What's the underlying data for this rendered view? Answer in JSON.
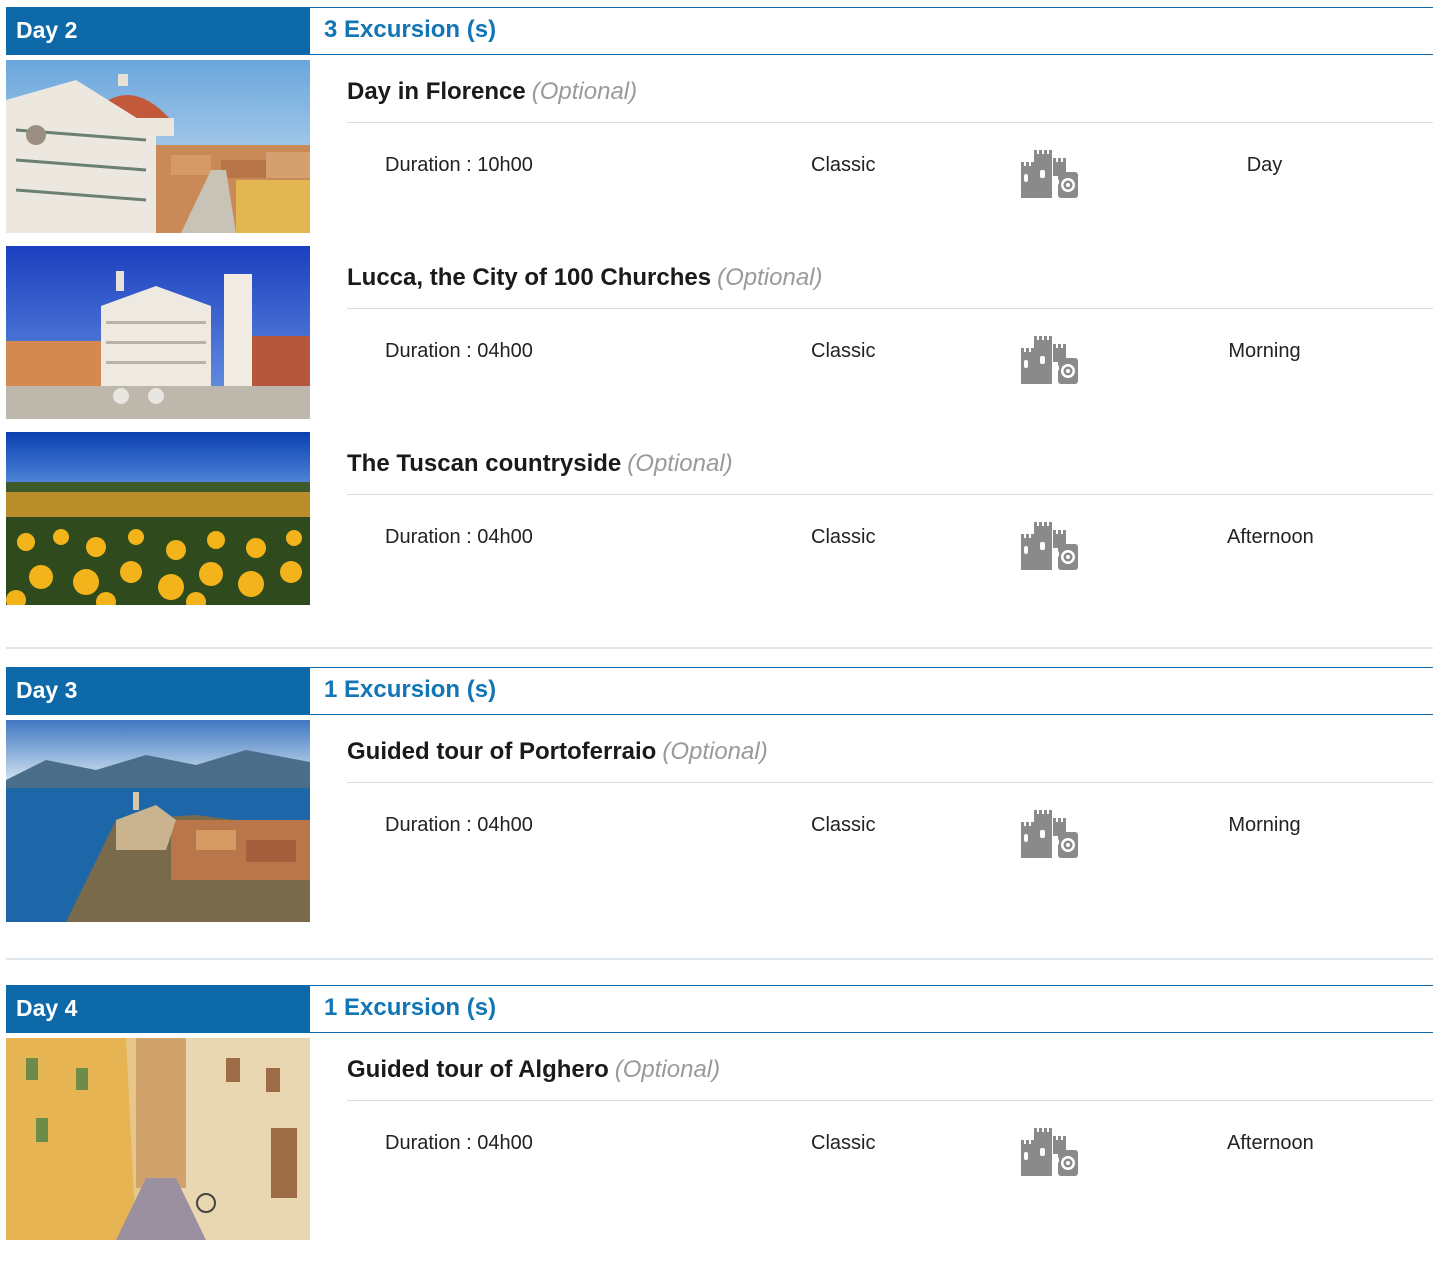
{
  "days": [
    {
      "label": "Day 2",
      "count": "3 Excursion (s)",
      "excursions": [
        {
          "title": "Day in Florence",
          "optional": "(Optional)",
          "duration": "Duration : 10h00",
          "category": "Classic",
          "period": "Day",
          "photo": "florence-duomo"
        },
        {
          "title": "Lucca, the City of 100 Churches",
          "optional": "(Optional)",
          "duration": "Duration : 04h00",
          "category": "Classic",
          "period": "Morning",
          "photo": "lucca-church"
        },
        {
          "title": "The Tuscan countryside",
          "optional": "(Optional)",
          "duration": "Duration : 04h00",
          "category": "Classic",
          "period": "Afternoon",
          "photo": "sunflower-field"
        }
      ]
    },
    {
      "label": "Day 3",
      "count": "1 Excursion (s)",
      "excursions": [
        {
          "title": "Guided tour of Portoferraio",
          "optional": "(Optional)",
          "duration": "Duration : 04h00",
          "category": "Classic",
          "period": "Morning",
          "photo": "portoferraio-coast"
        }
      ]
    },
    {
      "label": "Day 4",
      "count": "1 Excursion (s)",
      "excursions": [
        {
          "title": "Guided tour of Alghero",
          "optional": "(Optional)",
          "duration": "Duration : 04h00",
          "category": "Classic",
          "period": "Afternoon",
          "photo": "alghero-street"
        }
      ]
    }
  ],
  "icon": "city-castle-camera-icon",
  "colors": {
    "header_bg": "#0e69a9",
    "accent": "#1276b6",
    "optional": "#9a9a9a",
    "icon": "#8a8a8a"
  }
}
